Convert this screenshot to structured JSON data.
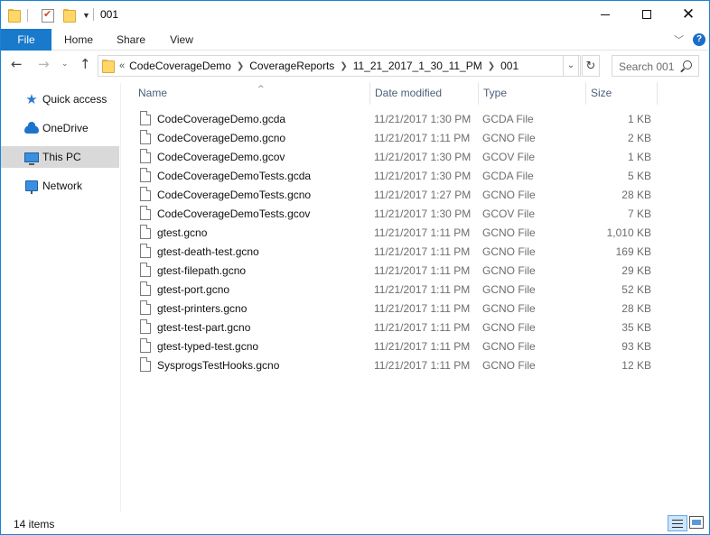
{
  "window": {
    "title": "001"
  },
  "ribbon": {
    "tabs": [
      "File",
      "Home",
      "Share",
      "View"
    ]
  },
  "address": {
    "overflow": "«",
    "crumbs": [
      "CodeCoverageDemo",
      "CoverageReports",
      "11_21_2017_1_30_11_PM",
      "001"
    ]
  },
  "search": {
    "placeholder": "Search 001"
  },
  "sidebar": {
    "items": [
      {
        "label": "Quick access",
        "icon": "star-icon"
      },
      {
        "label": "OneDrive",
        "icon": "cloud-icon"
      },
      {
        "label": "This PC",
        "icon": "computer-icon",
        "selected": true
      },
      {
        "label": "Network",
        "icon": "network-icon"
      }
    ]
  },
  "columns": {
    "name": "Name",
    "date": "Date modified",
    "type": "Type",
    "size": "Size"
  },
  "files": [
    {
      "name": "CodeCoverageDemo.gcda",
      "date": "11/21/2017 1:30 PM",
      "type": "GCDA File",
      "size": "1 KB"
    },
    {
      "name": "CodeCoverageDemo.gcno",
      "date": "11/21/2017 1:11 PM",
      "type": "GCNO File",
      "size": "2 KB"
    },
    {
      "name": "CodeCoverageDemo.gcov",
      "date": "11/21/2017 1:30 PM",
      "type": "GCOV File",
      "size": "1 KB"
    },
    {
      "name": "CodeCoverageDemoTests.gcda",
      "date": "11/21/2017 1:30 PM",
      "type": "GCDA File",
      "size": "5 KB"
    },
    {
      "name": "CodeCoverageDemoTests.gcno",
      "date": "11/21/2017 1:27 PM",
      "type": "GCNO File",
      "size": "28 KB"
    },
    {
      "name": "CodeCoverageDemoTests.gcov",
      "date": "11/21/2017 1:30 PM",
      "type": "GCOV File",
      "size": "7 KB"
    },
    {
      "name": "gtest.gcno",
      "date": "11/21/2017 1:11 PM",
      "type": "GCNO File",
      "size": "1,010 KB"
    },
    {
      "name": "gtest-death-test.gcno",
      "date": "11/21/2017 1:11 PM",
      "type": "GCNO File",
      "size": "169 KB"
    },
    {
      "name": "gtest-filepath.gcno",
      "date": "11/21/2017 1:11 PM",
      "type": "GCNO File",
      "size": "29 KB"
    },
    {
      "name": "gtest-port.gcno",
      "date": "11/21/2017 1:11 PM",
      "type": "GCNO File",
      "size": "52 KB"
    },
    {
      "name": "gtest-printers.gcno",
      "date": "11/21/2017 1:11 PM",
      "type": "GCNO File",
      "size": "28 KB"
    },
    {
      "name": "gtest-test-part.gcno",
      "date": "11/21/2017 1:11 PM",
      "type": "GCNO File",
      "size": "35 KB"
    },
    {
      "name": "gtest-typed-test.gcno",
      "date": "11/21/2017 1:11 PM",
      "type": "GCNO File",
      "size": "93 KB"
    },
    {
      "name": "SysprogsTestHooks.gcno",
      "date": "11/21/2017 1:11 PM",
      "type": "GCNO File",
      "size": "12 KB"
    }
  ],
  "status": {
    "count": "14 items"
  },
  "colors": {
    "accent": "#1979ca",
    "border": "#1883d7",
    "selected_nav": "#d9d9d9",
    "header_text": "#4c607a"
  }
}
